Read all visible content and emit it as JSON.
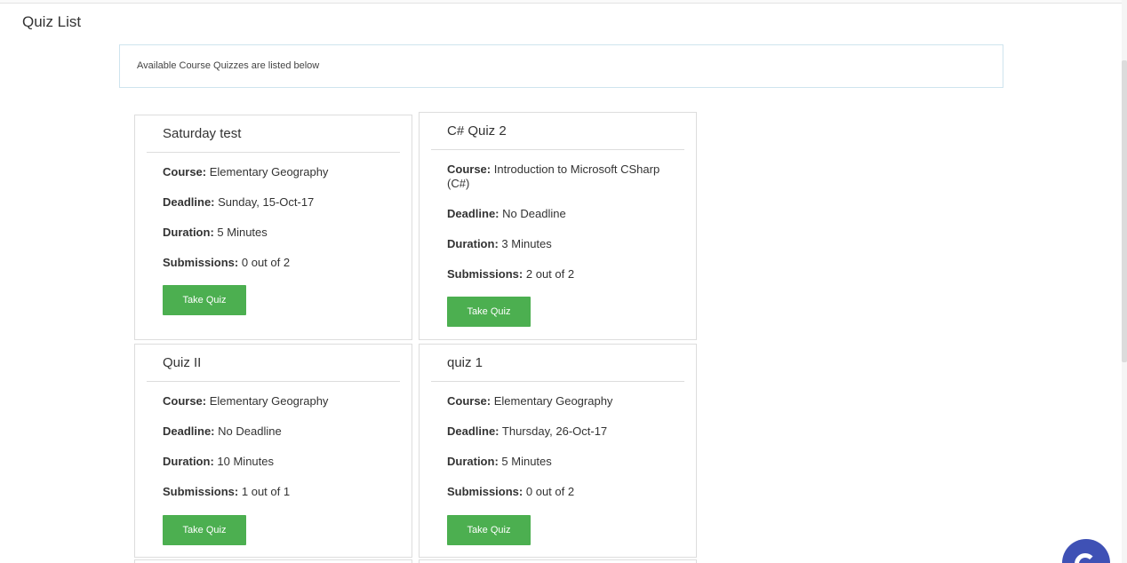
{
  "page": {
    "title": "Quiz List",
    "info": "Available Course Quizzes are listed below"
  },
  "labels": {
    "course": "Course:",
    "deadline": "Deadline:",
    "duration": "Duration:",
    "submissions": "Submissions:",
    "take_quiz": "Take Quiz"
  },
  "quizzes": [
    {
      "title": "Saturday test",
      "course": "Elementary Geography",
      "deadline": "Sunday, 15-Oct-17",
      "duration": "5 Minutes",
      "submissions": "0 out of 2"
    },
    {
      "title": "C# Quiz 2",
      "course": "Introduction to Microsoft CSharp (C#)",
      "deadline": "No Deadline",
      "duration": "3 Minutes",
      "submissions": "2 out of 2"
    },
    {
      "title": "Quiz II",
      "course": "Elementary Geography",
      "deadline": "No Deadline",
      "duration": "10 Minutes",
      "submissions": "1 out of 1"
    },
    {
      "title": "quiz 1",
      "course": "Elementary Geography",
      "deadline": "Thursday, 26-Oct-17",
      "duration": "5 Minutes",
      "submissions": "0 out of 2"
    }
  ],
  "colors": {
    "button": "#4caf50",
    "chat_widget": "#3f51b5",
    "info_border": "#cfe4ee"
  },
  "icons": {
    "chat": "chat-bubble-icon"
  }
}
